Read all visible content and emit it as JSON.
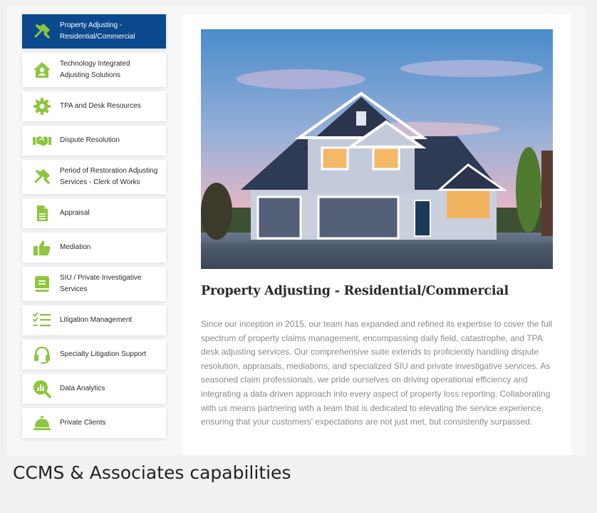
{
  "sidebar": {
    "accent_color": "#8dc63f",
    "active_color": "#0a4a8c",
    "items": [
      {
        "label_line1": "Property Adjusting -",
        "label_line2": "Residential/Commercial",
        "icon": "tools-icon",
        "active": true
      },
      {
        "label_line1": "Technology Integrated",
        "label_line2": "Adjusting Solutions",
        "icon": "house-user-icon",
        "active": false
      },
      {
        "label_line1": "TPA and Desk Resources",
        "label_line2": "",
        "icon": "gear-icon",
        "active": false
      },
      {
        "label_line1": "Dispute Resolution",
        "label_line2": "",
        "icon": "handshake-icon",
        "active": false
      },
      {
        "label_line1": "Period of Restoration Adjusting",
        "label_line2": "Services - Clerk of Works",
        "icon": "tools-icon",
        "active": false
      },
      {
        "label_line1": "Appraisal",
        "label_line2": "",
        "icon": "document-icon",
        "active": false
      },
      {
        "label_line1": "Mediation",
        "label_line2": "",
        "icon": "thumbs-up-icon",
        "active": false
      },
      {
        "label_line1": "SIU / Private Investigative",
        "label_line2": "Services",
        "icon": "book-icon",
        "active": false
      },
      {
        "label_line1": "Litigation Management",
        "label_line2": "",
        "icon": "checklist-icon",
        "active": false
      },
      {
        "label_line1": "Specialty Litigation Support",
        "label_line2": "",
        "icon": "headset-icon",
        "active": false
      },
      {
        "label_line1": "Data Analytics",
        "label_line2": "",
        "icon": "chart-magnifier-icon",
        "active": false
      },
      {
        "label_line1": "Private Clients",
        "label_line2": "",
        "icon": "service-bell-icon",
        "active": false
      }
    ]
  },
  "main": {
    "title": "Property Adjusting - Residential/Commercial",
    "body": "Since our inception in 2015, our team has expanded and refined its expertise to cover the full spectrum of property claims management, encompassing daily field, catastrophe, and TPA desk adjusting services. Our comprehensive suite extends to proficiently handling dispute resolution, appraisals, mediations, and specialized SIU and private investigative services. As seasoned claim professionals, we pride ourselves on driving operational efficiency and integrating a data-driven approach into every aspect of property loss reporting. Collaborating with us means partnering with a team that is dedicated to elevating the service experience, ensuring that your customers' expectations are not just met, but consistently surpassed.",
    "image": "house-photo"
  },
  "caption": "CCMS & Associates capabilities"
}
